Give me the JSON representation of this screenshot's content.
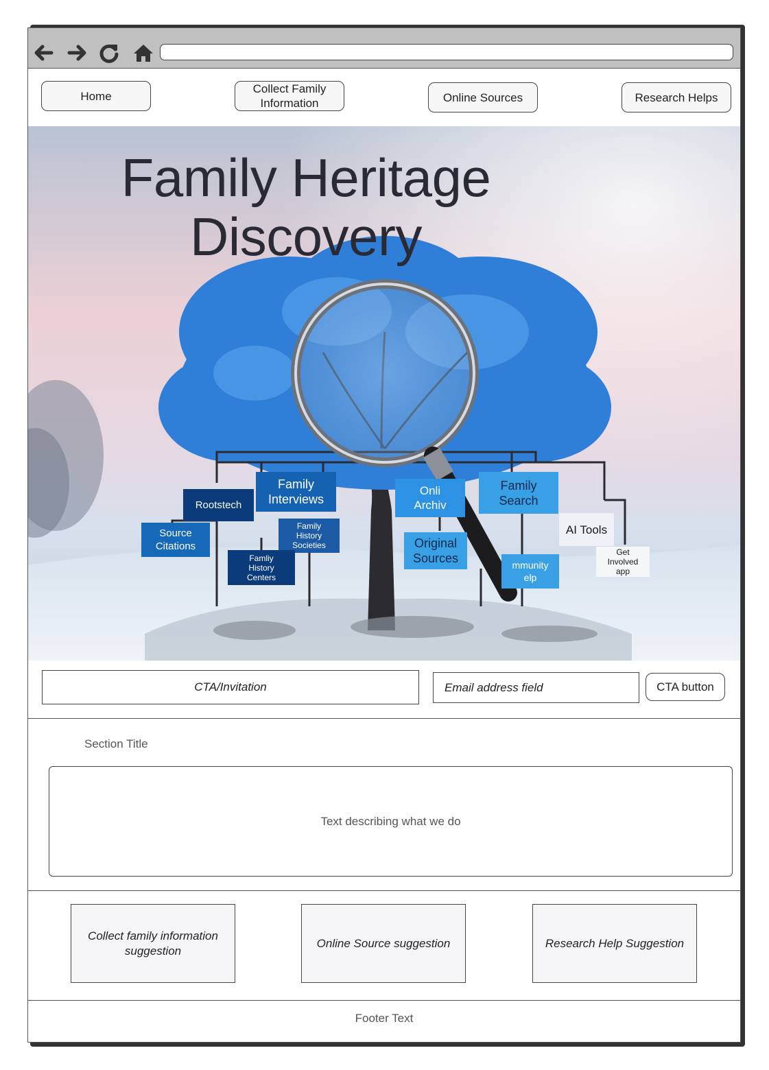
{
  "browser": {
    "icons": [
      "back-arrow-icon",
      "forward-arrow-icon",
      "reload-icon",
      "home-icon"
    ],
    "url": ""
  },
  "nav": {
    "items": [
      "Home",
      "Collect Family Information",
      "Online Sources",
      "Research Helps"
    ]
  },
  "hero": {
    "title_line1": "Family Heritage",
    "title_line2": "Discovery",
    "tree_labels": {
      "rootstech": "Rootstech",
      "family_interviews": "Family Interviews",
      "source_citations": "Source Citations",
      "family_history_societies": "Family History Societies",
      "family_history_centers": "Famliy History Centers",
      "online_archives": "Onli Archiv",
      "family_search": "Family Search",
      "original_sources": "Original Sources",
      "community_help": "mmunity elp",
      "ai_tools": "AI Tools",
      "get_involved_app": "Get Involved app"
    },
    "colors": {
      "tree": "#2f7fd8",
      "dark_box": "#0b3b7a",
      "mid_box": "#1668b8",
      "light_box": "#3aa0e6"
    }
  },
  "cta": {
    "invitation": "CTA/Invitation",
    "email_placeholder": "Email address field",
    "button_label": "CTA button"
  },
  "about": {
    "section_title": "Section Title",
    "description": "Text describing what we do"
  },
  "suggestions": [
    "Collect family information suggestion",
    "Online Source suggestion",
    "Research Help Suggestion"
  ],
  "footer": {
    "text": "Footer Text"
  }
}
